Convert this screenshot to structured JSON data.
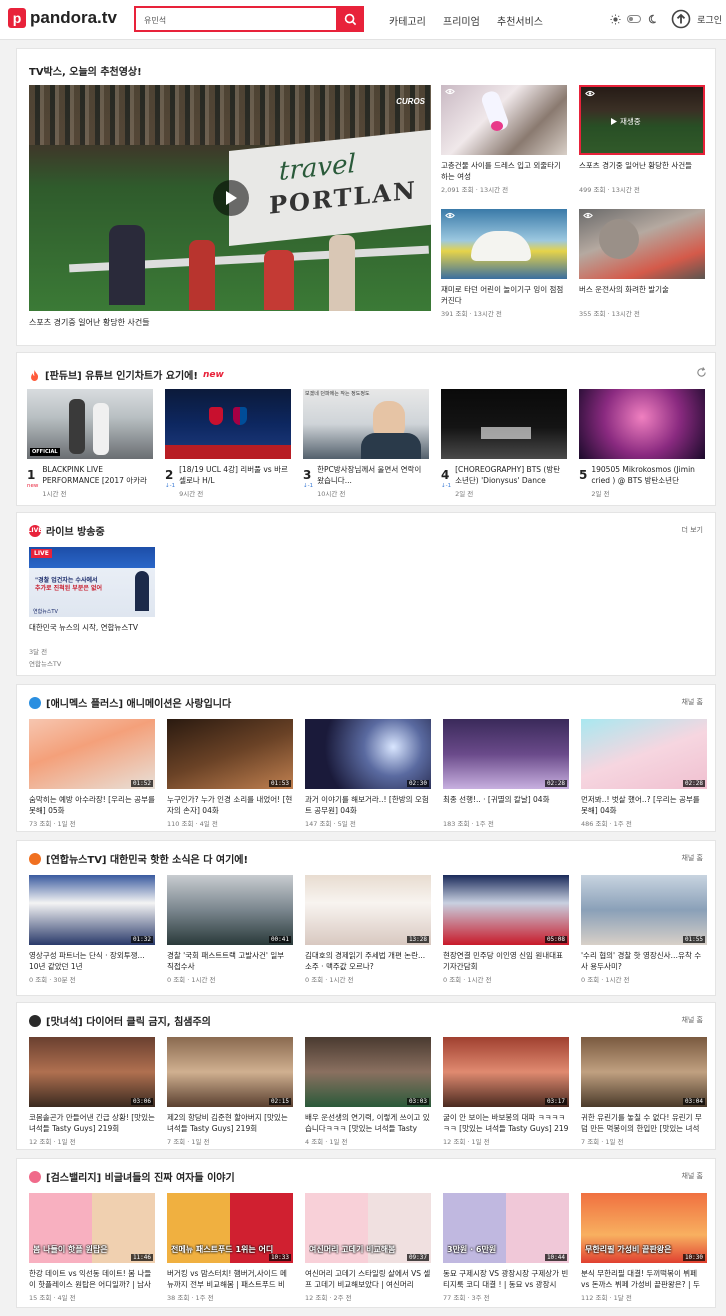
{
  "header": {
    "logo_mark": "p",
    "logo_text": "pandora.tv",
    "search_value": "유민석",
    "nav": [
      "카테고리",
      "프리미엄",
      "추천서비스"
    ],
    "login": "로그인"
  },
  "s1": {
    "title": "TV박스, 오늘의 추천영상!",
    "main_title": "스포츠 경기중 일어난 황당한 사건들",
    "main_brand": "CUROS",
    "main_banner_1": "travel",
    "main_banner_2": "PORTLAN",
    "cards": [
      {
        "title": "고층건물 사이를 드레스 입고 외줄타기 하는 여성",
        "meta": "2,091 조회 · 13시간 전"
      },
      {
        "title": "스포츠 경기중 일어난 황당한 사건들",
        "meta": "499 조회 · 13시간 전",
        "playing": "재생중"
      },
      {
        "title": "재미로 타던 어린이 놀이기구 잉이 점점 커진다",
        "meta": "391 조회 · 13시간 전"
      },
      {
        "title": "버스 운전사의 화려한 발기술",
        "meta": "355 조회 · 13시간 전"
      }
    ]
  },
  "s2": {
    "title": "[판듀브] 유튜브 인기차트가 요기에!",
    "new": "new",
    "items": [
      {
        "rank": "1",
        "sub": "new",
        "title": "BLACKPINK LIVE PERFORMANCE [2017 아카라",
        "meta": "1시간 전",
        "logo": "OFFICIAL"
      },
      {
        "rank": "2",
        "sub": "↓-1",
        "title": "[18/19 UCL 4강] 리버풀 vs 바르셀로나 H/L",
        "meta": "9시간 전"
      },
      {
        "rank": "3",
        "sub": "↓-1",
        "title": "한PC방사장님께서 울면서 연락이 왔습니다...",
        "meta": "10시간 전",
        "overlay": "보겠네 던파에는 작는 정도정도"
      },
      {
        "rank": "4",
        "sub": "↓-1",
        "title": "[CHOREOGRAPHY] BTS (방탄소년단) 'Dionysus' Dance",
        "meta": "2일 전"
      },
      {
        "rank": "5",
        "sub": "",
        "title": "190505 Mikrokosmos (Jimin cried ) @ BTS 방탄소년단",
        "meta": "2일 전"
      }
    ]
  },
  "s3": {
    "title": "라이브 방송중",
    "more": "더 보기",
    "badge": "LIVE",
    "live_tag": "LIVE",
    "caption_1": "\"경찰 업건자는 수사에서",
    "caption_2": "추가로 진척된 부분은 없어",
    "news": "연합뉴스TV",
    "card_title": "대한민국 뉴스의 시작, 연합뉴스TV",
    "age": "3달 전",
    "channel": "연합뉴스TV"
  },
  "s4": {
    "title": "[애니멕스 플러스] 애니메이션은 사랑입니다",
    "more": "채널 홈",
    "cards": [
      {
        "title": "숨막히는 예방 아수라장! [우리는 공부를 못해] 05화",
        "meta": "73 조회 · 1일 전",
        "dur": "01:52"
      },
      {
        "title": "누구인가? 누가 인경 소리를 내었어! [현자의 손자] 04화",
        "meta": "110 조회 · 4일 전",
        "dur": "01:53"
      },
      {
        "title": "과거 이야기를 해보거라..! [한방의 오험 트 공무원] 04화",
        "meta": "147 조회 · 5일 전",
        "dur": "02:30"
      },
      {
        "title": "최종 선행!.. · [귀멸의 칼날] 04화",
        "meta": "183 조회 · 1주 전",
        "dur": "02:28"
      },
      {
        "title": "먼저봐..! 벗살 했어..? [우리는 공부를 못해] 04화",
        "meta": "486 조회 · 1주 전",
        "dur": "02:28"
      }
    ]
  },
  "s5": {
    "title": "[연합뉴스TV] 대한민국 핫한 소식은 다 여기에!",
    "more": "채널 홈",
    "cards": [
      {
        "title": "영상구성 파트너는 단식 · 장외투쟁... 10년 같았던 1년",
        "meta": "0 조회 · 30분 전",
        "dur": "01:32"
      },
      {
        "title": "경찰 '국회 패스트트랙 고발사건' 일부 직접수사",
        "meta": "0 조회 · 1시간 전",
        "dur": "00:41"
      },
      {
        "title": "김대호의 경제읽기 주세법 개편 논란... 소주 · 맥주값 오르나?",
        "meta": "0 조회 · 1시간 전",
        "dur": "13:28"
      },
      {
        "title": "현장연결 민주당 이인영 신임 원내대표 기자간담회",
        "meta": "0 조회 · 1시간 전",
        "dur": "05:08"
      },
      {
        "title": "'수리 협의' 경찰 핫 영장신사…유착 수사 용두사미?",
        "meta": "0 조회 · 1시간 전",
        "dur": "01:55"
      }
    ]
  },
  "s6": {
    "title": "[맛녀석] 다이어터 클릭 금지, 침샘주의",
    "more": "채널 홈",
    "cards": [
      {
        "title": "코몸솔곤가 만들어낸 긴급 상황! [맛있는 녀석들 Tasty Guys] 219회",
        "meta": "12 조회 · 1일 전",
        "dur": "03:06"
      },
      {
        "title": "제2의 항당비 김준현 할아버지 [맛있는 녀석들 Tasty Guys] 219회",
        "meta": "7 조회 · 1일 전",
        "dur": "02:15"
      },
      {
        "title": "배우 운선생의 연기력, 이렇게 쓰이고 있습니다ㅋㅋㅋ [맛있는 녀석들 Tasty",
        "meta": "4 조회 · 1일 전",
        "dur": "03:03"
      },
      {
        "title": "굴이 안 보이는 바보봉의 대파 ㅋㅋㅋㅋㅋㅋ [맛있는 녀석들 Tasty Guys] 219",
        "meta": "12 조회 · 1일 전",
        "dur": "03:17"
      },
      {
        "title": "귀한 유린기를 놓칠 수 없다! 유린기 무덤 만든 먹봉이의 한입만 [맛있는 녀석",
        "meta": "7 조회 · 1일 전",
        "dur": "03:04"
      }
    ]
  },
  "s7": {
    "title": "[검스밸리지] 비글녀들의 진짜 여자들 이야기",
    "more": "채널 홈",
    "cards": [
      {
        "title": "한강 데이트 vs 익선동 데이트! 봄 나들이 핫플레이스 원탑은 어디일까? | 남사",
        "meta": "15 조회 · 4일 전",
        "dur": "11:46",
        "cap": "봄 나들이 핫플 원탑은"
      },
      {
        "title": "버거킹 vs 맘스터치! 햄버거,사이드 메뉴까지 전부 비교해봄 | 패스트푸드 비",
        "meta": "38 조회 · 1주 전",
        "dur": "10:33",
        "cap": "전메뉴 패스트푸드 1위는 어디?"
      },
      {
        "title": "여신머리 고데기 스타일링 살에서 VS 셀프 고데기 비교해보았다 | 여신머리",
        "meta": "12 조회 · 2주 전",
        "dur": "09:37",
        "cap": "여신머리 고데기 비교해봄"
      },
      {
        "title": "동묘 구제시장 VS 광장시장 구제상가 빈티지룩 코디 대결 ! | 동묘 vs 광장시",
        "meta": "77 조회 · 3주 전",
        "dur": "10:44",
        "cap": "3만원 · 6만원"
      },
      {
        "title": "분식 무한리필 대결! 두끼떡볶이 뷔페 vs 돈까스 뷔페 가성비 끝판왕은? | 두",
        "meta": "112 조회 · 1달 전",
        "dur": "10:30",
        "cap": "무한리필 가성비 끝판왕은"
      }
    ]
  }
}
